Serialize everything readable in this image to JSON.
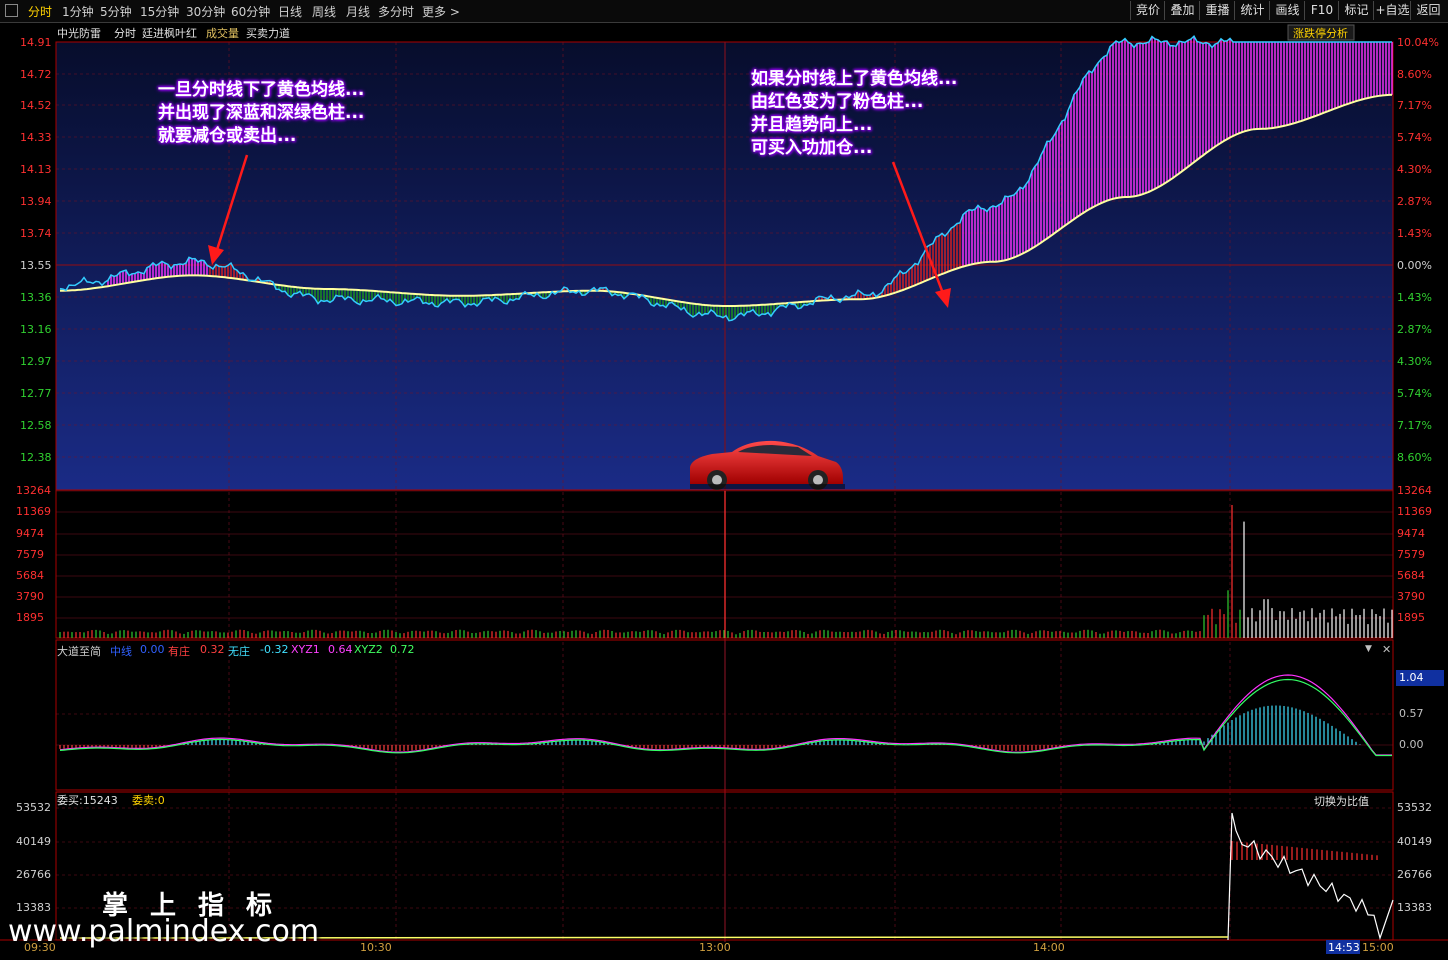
{
  "toolbar": {
    "periods": [
      "分时",
      "1分钟",
      "5分钟",
      "15分钟",
      "30分钟",
      "60分钟",
      "日线",
      "周线",
      "月线",
      "多分时",
      "更多 >"
    ],
    "active": "分时",
    "right": [
      "竞价",
      "叠加",
      "重播",
      "统计",
      "画线",
      "F10",
      "标记",
      "+自选",
      "返回"
    ]
  },
  "price_header": {
    "stock": "中光防雷",
    "mode": "分时",
    "indicator": "廷进枫叶红",
    "volume": "成交量",
    "power": "买卖力道",
    "limit_button": "涨跌停分析"
  },
  "price_axis": {
    "left": [
      "14.91",
      "14.72",
      "14.52",
      "14.33",
      "14.13",
      "13.94",
      "13.74",
      "13.55",
      "13.36",
      "13.16",
      "12.97",
      "12.77",
      "12.58",
      "12.38"
    ],
    "right": [
      "10.04%",
      "8.60%",
      "7.17%",
      "5.74%",
      "4.30%",
      "2.87%",
      "1.43%",
      "0.00%",
      "1.43%",
      "2.87%",
      "4.30%",
      "5.74%",
      "7.17%",
      "8.60%"
    ]
  },
  "volume_axis": [
    "13264",
    "11369",
    "9474",
    "7579",
    "5684",
    "3790",
    "1895"
  ],
  "indicator_header": {
    "name": "大道至简",
    "l1": "中线",
    "v1": "0.00",
    "l2": "有庄",
    "v2": "0.32",
    "l3": "无庄",
    "v3": "-0.32",
    "l4": "XYZ1",
    "v4": "0.64",
    "l5": "XYZ2",
    "v5": "0.72"
  },
  "indicator_axis": [
    "1.04",
    "0.57",
    "0.00"
  ],
  "order_header": {
    "buy_label": "委买:15243",
    "sell_label": "委卖:0",
    "switch": "切换为比值"
  },
  "order_axis": [
    "53532",
    "40149",
    "26766",
    "13383"
  ],
  "time_axis": [
    "09:30",
    "10:30",
    "13:00",
    "14:00",
    "14:53",
    "15:00"
  ],
  "annotations": {
    "left": [
      "一旦分时线下了黄色均线...",
      "并出现了深蓝和深绿色柱...",
      "就要减仓或卖出..."
    ],
    "right": [
      "如果分时线上了黄色均线...",
      "由红色变为了粉色柱...",
      "并且趋势向上...",
      "可买入功加仓..."
    ]
  },
  "watermark": {
    "cn": "掌上指标",
    "url": "www.palmindex.com"
  },
  "colors": {
    "price": "#33ccff",
    "avg": "#ffff99",
    "up": "#ff3333",
    "down": "#00cc66",
    "pink": "#ff33ff",
    "green": "#33aa33",
    "grid": "#8b0000"
  },
  "chart_data": {
    "type": "line",
    "title": "",
    "prev_close": 13.55,
    "ylim": [
      12.28,
      14.91
    ],
    "x": [
      "09:30",
      "10:00",
      "10:30",
      "11:00",
      "11:30/13:00",
      "13:30",
      "14:00",
      "14:20",
      "14:40",
      "14:53",
      "15:00"
    ],
    "series": [
      {
        "name": "price",
        "values": [
          13.48,
          13.62,
          13.4,
          13.38,
          13.45,
          13.3,
          13.42,
          13.95,
          14.91,
          14.91,
          14.91
        ]
      },
      {
        "name": "avg",
        "values": [
          13.45,
          13.54,
          13.46,
          13.42,
          13.45,
          13.36,
          13.4,
          13.62,
          14.0,
          14.4,
          14.6
        ]
      }
    ],
    "volume_max": 13264
  }
}
